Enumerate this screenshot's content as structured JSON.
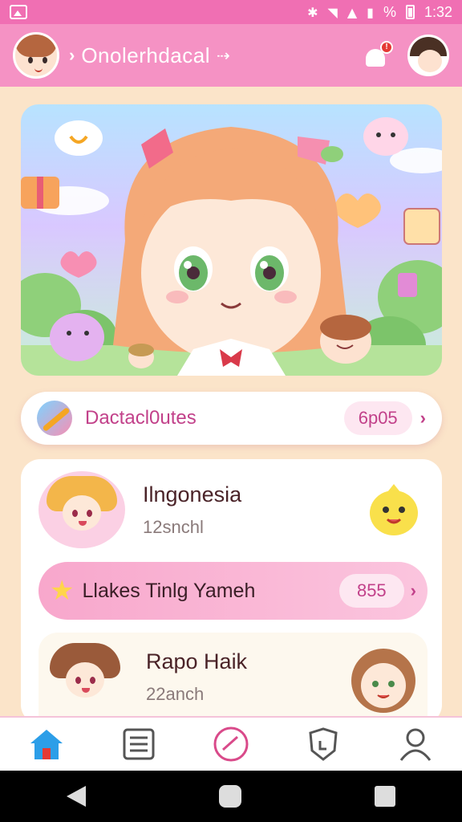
{
  "status_bar": {
    "battery_pct": "%",
    "time": "1:32"
  },
  "header": {
    "title": "Onolerhdacal"
  },
  "promo_pill": {
    "label": "Dactacl0utes",
    "count": "6p05"
  },
  "cards": [
    {
      "name": "Ilngonesia",
      "subtitle": "12snchl",
      "avatar_hair": "#f3b64a"
    },
    {
      "name": "Llakes Tinlg Yameh",
      "count": "855"
    },
    {
      "name": "Rapo Haik",
      "subtitle": "22anch",
      "avatar_hair": "#9a5a3a"
    }
  ],
  "bottom_nav": [
    {
      "icon": "home-icon",
      "active": true
    },
    {
      "icon": "list-icon",
      "active": false
    },
    {
      "icon": "check-circle-icon",
      "active": false
    },
    {
      "icon": "shield-icon",
      "active": false
    },
    {
      "icon": "profile-icon",
      "active": false
    }
  ],
  "colors": {
    "header_bg": "#f592c4",
    "statusbar_bg": "#f06fb3",
    "page_bg": "#fbe4c9",
    "accent": "#c2418a"
  }
}
